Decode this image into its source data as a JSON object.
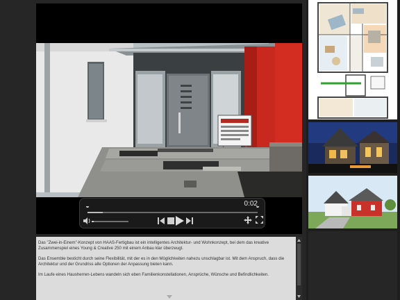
{
  "player": {
    "elapsed": "0:02",
    "progress": 0.09
  },
  "description": {
    "paragraphs": [
      "Das \"Zwei-in-Einem\"-Konzept von HAAS-Fertigbau ist ein intelligentes Architektur- und Wohnkonzept, bei dem das kreative Zusammenspiel eines Young & Creative 250 mit einem Anbau klar überzeugt.",
      "Das Ensemble besticht durch seine Flexibilität, mit der es in den Möglichkeiten nahezu unschlagbar ist. Mit dem Anspruch, dass die Architektur und der Grundriss alle Optionen der Anpassung bieten kann.",
      "Im Laufe eines Hausherren-Lebens wandeln sich eben Familienkonstellationen, Ansprüche, Wünsche und Befindlichkeiten."
    ]
  },
  "gallery": {
    "items": [
      {
        "name": "Grundriss"
      },
      {
        "name": "Nachtansicht"
      },
      {
        "name": "Außenansicht"
      }
    ]
  },
  "colors": {
    "accent_red": "#c8281e",
    "player_bg": "#1c1c1c",
    "text_panel_bg": "#dcdcdc"
  }
}
